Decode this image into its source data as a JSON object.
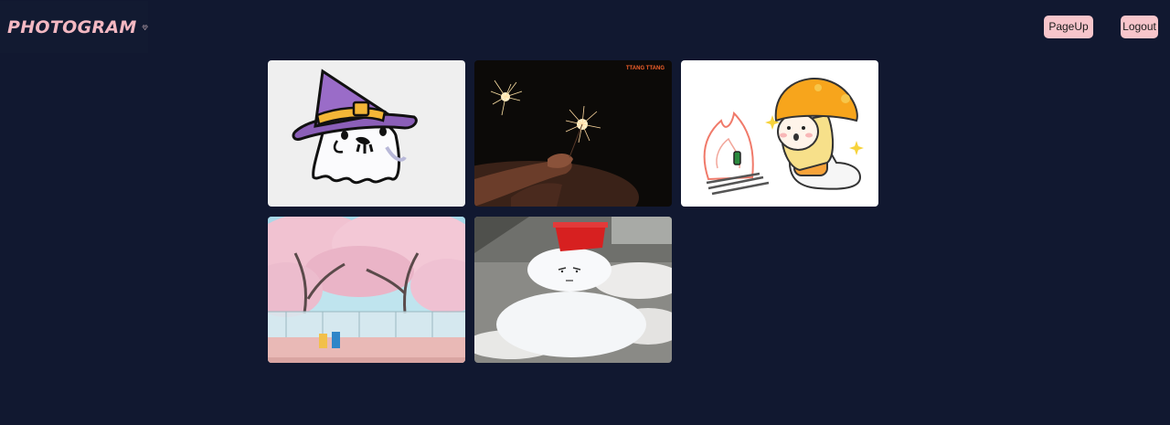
{
  "app": {
    "logo_text": "PHOTOGRAM",
    "logo_icon": "geometric-heart-icon",
    "accent_color": "#f7c5cb",
    "background_color": "#111830"
  },
  "header": {
    "pageup_label": "PageUp",
    "logout_label": "Logout"
  },
  "gallery": {
    "photos": [
      {
        "subject": "ghost-witch-hat"
      },
      {
        "subject": "sparklers-night",
        "watermark": "TTANG TTANG"
      },
      {
        "subject": "girl-mushroom-hat-fire"
      },
      {
        "subject": "cherry-blossom-trees"
      },
      {
        "subject": "snowman-red-bucket"
      }
    ]
  }
}
